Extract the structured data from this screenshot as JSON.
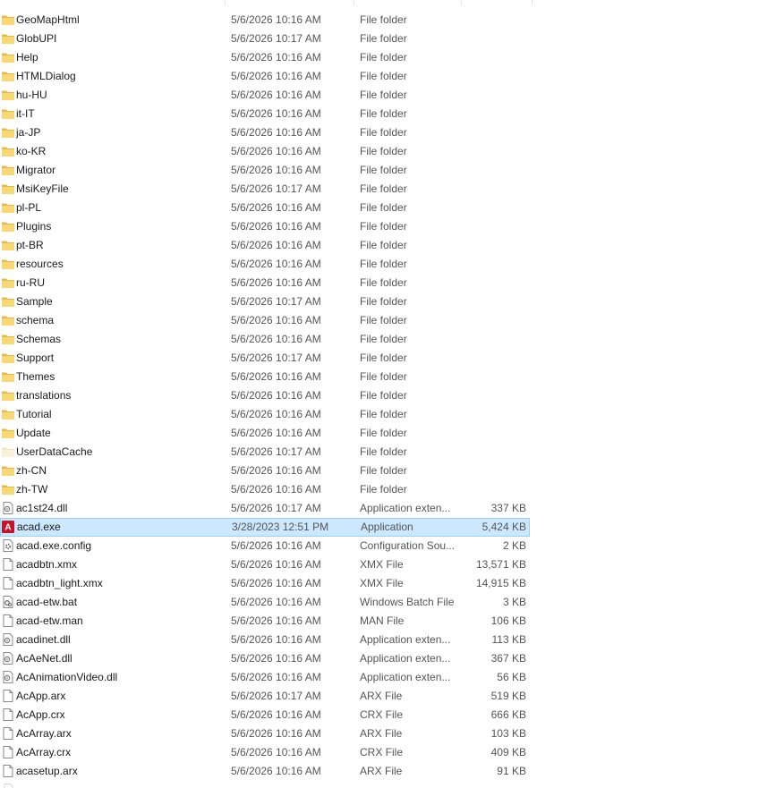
{
  "files": [
    {
      "name": "GeoMapHtml",
      "date": "5/6/2026 10:16 AM",
      "type": "File folder",
      "size": "",
      "icon": "folder-icon"
    },
    {
      "name": "GlobUPI",
      "date": "5/6/2026 10:17 AM",
      "type": "File folder",
      "size": "",
      "icon": "folder-icon"
    },
    {
      "name": "Help",
      "date": "5/6/2026 10:16 AM",
      "type": "File folder",
      "size": "",
      "icon": "folder-icon"
    },
    {
      "name": "HTMLDialog",
      "date": "5/6/2026 10:16 AM",
      "type": "File folder",
      "size": "",
      "icon": "folder-icon"
    },
    {
      "name": "hu-HU",
      "date": "5/6/2026 10:16 AM",
      "type": "File folder",
      "size": "",
      "icon": "folder-icon"
    },
    {
      "name": "it-IT",
      "date": "5/6/2026 10:16 AM",
      "type": "File folder",
      "size": "",
      "icon": "folder-icon"
    },
    {
      "name": "ja-JP",
      "date": "5/6/2026 10:16 AM",
      "type": "File folder",
      "size": "",
      "icon": "folder-icon"
    },
    {
      "name": "ko-KR",
      "date": "5/6/2026 10:16 AM",
      "type": "File folder",
      "size": "",
      "icon": "folder-icon"
    },
    {
      "name": "Migrator",
      "date": "5/6/2026 10:16 AM",
      "type": "File folder",
      "size": "",
      "icon": "folder-icon"
    },
    {
      "name": "MsiKeyFile",
      "date": "5/6/2026 10:17 AM",
      "type": "File folder",
      "size": "",
      "icon": "folder-icon"
    },
    {
      "name": "pl-PL",
      "date": "5/6/2026 10:16 AM",
      "type": "File folder",
      "size": "",
      "icon": "folder-icon"
    },
    {
      "name": "Plugins",
      "date": "5/6/2026 10:16 AM",
      "type": "File folder",
      "size": "",
      "icon": "folder-icon"
    },
    {
      "name": "pt-BR",
      "date": "5/6/2026 10:16 AM",
      "type": "File folder",
      "size": "",
      "icon": "folder-icon"
    },
    {
      "name": "resources",
      "date": "5/6/2026 10:16 AM",
      "type": "File folder",
      "size": "",
      "icon": "folder-icon"
    },
    {
      "name": "ru-RU",
      "date": "5/6/2026 10:16 AM",
      "type": "File folder",
      "size": "",
      "icon": "folder-icon"
    },
    {
      "name": "Sample",
      "date": "5/6/2026 10:17 AM",
      "type": "File folder",
      "size": "",
      "icon": "folder-icon"
    },
    {
      "name": "schema",
      "date": "5/6/2026 10:16 AM",
      "type": "File folder",
      "size": "",
      "icon": "folder-icon"
    },
    {
      "name": "Schemas",
      "date": "5/6/2026 10:16 AM",
      "type": "File folder",
      "size": "",
      "icon": "folder-icon"
    },
    {
      "name": "Support",
      "date": "5/6/2026 10:17 AM",
      "type": "File folder",
      "size": "",
      "icon": "folder-icon"
    },
    {
      "name": "Themes",
      "date": "5/6/2026 10:16 AM",
      "type": "File folder",
      "size": "",
      "icon": "folder-icon"
    },
    {
      "name": "translations",
      "date": "5/6/2026 10:16 AM",
      "type": "File folder",
      "size": "",
      "icon": "folder-icon"
    },
    {
      "name": "Tutorial",
      "date": "5/6/2026 10:16 AM",
      "type": "File folder",
      "size": "",
      "icon": "folder-icon"
    },
    {
      "name": "Update",
      "date": "5/6/2026 10:16 AM",
      "type": "File folder",
      "size": "",
      "icon": "folder-icon"
    },
    {
      "name": "UserDataCache",
      "date": "5/6/2026 10:17 AM",
      "type": "File folder",
      "size": "",
      "icon": "folder-light-icon"
    },
    {
      "name": "zh-CN",
      "date": "5/6/2026 10:16 AM",
      "type": "File folder",
      "size": "",
      "icon": "folder-icon"
    },
    {
      "name": "zh-TW",
      "date": "5/6/2026 10:16 AM",
      "type": "File folder",
      "size": "",
      "icon": "folder-icon"
    },
    {
      "name": "ac1st24.dll",
      "date": "5/6/2026 10:17 AM",
      "type": "Application exten...",
      "size": "337 KB",
      "icon": "dll-icon"
    },
    {
      "name": "acad.exe",
      "date": "3/28/2023 12:51 PM",
      "type": "Application",
      "size": "5,424 KB",
      "icon": "autocad-app-icon",
      "selected": true
    },
    {
      "name": "acad.exe.config",
      "date": "5/6/2026 10:16 AM",
      "type": "Configuration Sou...",
      "size": "2 KB",
      "icon": "config-file-icon"
    },
    {
      "name": "acadbtn.xmx",
      "date": "5/6/2026 10:16 AM",
      "type": "XMX File",
      "size": "13,571 KB",
      "icon": "file-icon"
    },
    {
      "name": "acadbtn_light.xmx",
      "date": "5/6/2026 10:16 AM",
      "type": "XMX File",
      "size": "14,915 KB",
      "icon": "file-icon"
    },
    {
      "name": "acad-etw.bat",
      "date": "5/6/2026 10:16 AM",
      "type": "Windows Batch File",
      "size": "3 KB",
      "icon": "batch-file-icon"
    },
    {
      "name": "acad-etw.man",
      "date": "5/6/2026 10:16 AM",
      "type": "MAN File",
      "size": "106 KB",
      "icon": "file-icon"
    },
    {
      "name": "acadinet.dll",
      "date": "5/6/2026 10:16 AM",
      "type": "Application exten...",
      "size": "113 KB",
      "icon": "dll-icon"
    },
    {
      "name": "AcAeNet.dll",
      "date": "5/6/2026 10:16 AM",
      "type": "Application exten...",
      "size": "367 KB",
      "icon": "dll-icon"
    },
    {
      "name": "AcAnimationVideo.dll",
      "date": "5/6/2026 10:16 AM",
      "type": "Application exten...",
      "size": "56 KB",
      "icon": "dll-icon"
    },
    {
      "name": "AcApp.arx",
      "date": "5/6/2026 10:17 AM",
      "type": "ARX File",
      "size": "519 KB",
      "icon": "file-icon"
    },
    {
      "name": "AcApp.crx",
      "date": "5/6/2026 10:16 AM",
      "type": "CRX File",
      "size": "666 KB",
      "icon": "file-icon"
    },
    {
      "name": "AcArray.arx",
      "date": "5/6/2026 10:16 AM",
      "type": "ARX File",
      "size": "103 KB",
      "icon": "file-icon"
    },
    {
      "name": "AcArray.crx",
      "date": "5/6/2026 10:16 AM",
      "type": "CRX File",
      "size": "409 KB",
      "icon": "file-icon"
    },
    {
      "name": "acasetup.arx",
      "date": "5/6/2026 10:16 AM",
      "type": "ARX File",
      "size": "91 KB",
      "icon": "file-icon"
    }
  ],
  "colors": {
    "folder": "#f8d775",
    "folder_dark": "#e6b94a",
    "selection_bg": "#cce8ff",
    "selection_border": "#99d1ff",
    "autocad_red": "#c4162a"
  }
}
